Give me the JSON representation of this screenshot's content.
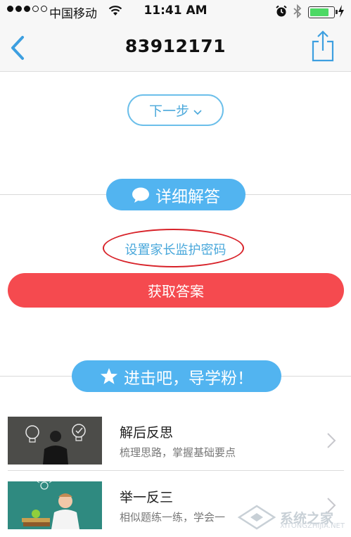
{
  "status_bar": {
    "carrier": "中国移动",
    "time": "11:41 AM",
    "signal_dots_filled": 3,
    "signal_dots_total": 5,
    "battery_level_percent": 80
  },
  "nav": {
    "title": "83912171",
    "back_icon": "chevron-left-icon",
    "share_icon": "share-icon"
  },
  "next_step": {
    "label": "下一步"
  },
  "detail_answer": {
    "label": "详细解答",
    "icon": "speech-bubble-icon"
  },
  "parent_password": {
    "label": "设置家长监护密码"
  },
  "get_answer": {
    "label": "获取答案"
  },
  "advance": {
    "label": "进击吧，导学粉！",
    "icon": "star-icon"
  },
  "list": [
    {
      "title": "解后反思",
      "subtitle": "梳理思路，掌握基础要点"
    },
    {
      "title": "举一反三",
      "subtitle": "相似题练一练，学会一"
    }
  ],
  "watermark": {
    "text": "系统之家",
    "url": "XITONGZHIJIA.NET"
  },
  "colors": {
    "accent_blue": "#52b4f0",
    "link_blue": "#4aa8db",
    "action_red": "#f54a4f",
    "annotation_red": "#d8232a"
  }
}
